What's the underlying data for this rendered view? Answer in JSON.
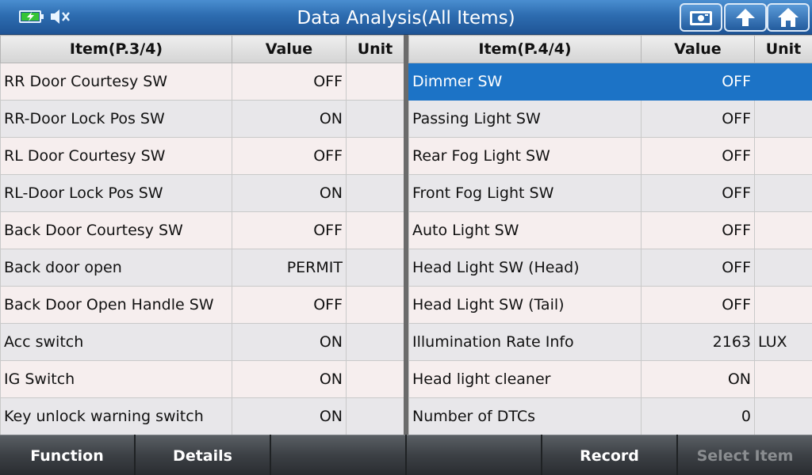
{
  "window": {
    "title": "Data Analysis(All Items)"
  },
  "colors": {
    "titlebar": "#2d6cb0",
    "selected_row": "#1c73c6",
    "battery_charge": "#36c436"
  },
  "icons": {
    "battery": "battery-charging-icon",
    "speaker": "speaker-muted-icon",
    "screenshot": "camera-icon",
    "back": "up-arrow-icon",
    "home": "home-icon"
  },
  "left_table": {
    "headers": {
      "item": "Item(P.3/4)",
      "value": "Value",
      "unit": "Unit"
    },
    "rows": [
      {
        "item": "RR Door Courtesy SW",
        "value": "OFF",
        "unit": ""
      },
      {
        "item": "RR-Door Lock Pos SW",
        "value": "ON",
        "unit": ""
      },
      {
        "item": "RL Door Courtesy SW",
        "value": "OFF",
        "unit": ""
      },
      {
        "item": "RL-Door Lock Pos SW",
        "value": "ON",
        "unit": ""
      },
      {
        "item": "Back Door Courtesy SW",
        "value": "OFF",
        "unit": ""
      },
      {
        "item": "Back door open",
        "value": "PERMIT",
        "unit": ""
      },
      {
        "item": "Back Door Open Handle SW",
        "value": "OFF",
        "unit": ""
      },
      {
        "item": "Acc switch",
        "value": "ON",
        "unit": ""
      },
      {
        "item": "IG Switch",
        "value": "ON",
        "unit": ""
      },
      {
        "item": "Key unlock warning switch",
        "value": "ON",
        "unit": ""
      }
    ]
  },
  "right_table": {
    "headers": {
      "item": "Item(P.4/4)",
      "value": "Value",
      "unit": "Unit"
    },
    "rows": [
      {
        "item": "Dimmer SW",
        "value": "OFF",
        "unit": "",
        "selected": true
      },
      {
        "item": "Passing Light SW",
        "value": "OFF",
        "unit": ""
      },
      {
        "item": "Rear Fog Light SW",
        "value": "OFF",
        "unit": ""
      },
      {
        "item": "Front Fog Light SW",
        "value": "OFF",
        "unit": ""
      },
      {
        "item": "Auto Light SW",
        "value": "OFF",
        "unit": ""
      },
      {
        "item": "Head Light SW (Head)",
        "value": "OFF",
        "unit": ""
      },
      {
        "item": "Head Light SW (Tail)",
        "value": "OFF",
        "unit": ""
      },
      {
        "item": "Illumination Rate Info",
        "value": "2163",
        "unit": "LUX"
      },
      {
        "item": "Head light cleaner",
        "value": "ON",
        "unit": ""
      },
      {
        "item": "Number of DTCs",
        "value": "0",
        "unit": ""
      }
    ]
  },
  "bottom_bar": {
    "buttons": [
      {
        "label": "Function",
        "enabled": true
      },
      {
        "label": "Details",
        "enabled": true
      },
      {
        "label": "",
        "enabled": true
      },
      {
        "label": "",
        "enabled": true
      },
      {
        "label": "Record",
        "enabled": true
      },
      {
        "label": "Select Item",
        "enabled": false
      }
    ]
  }
}
